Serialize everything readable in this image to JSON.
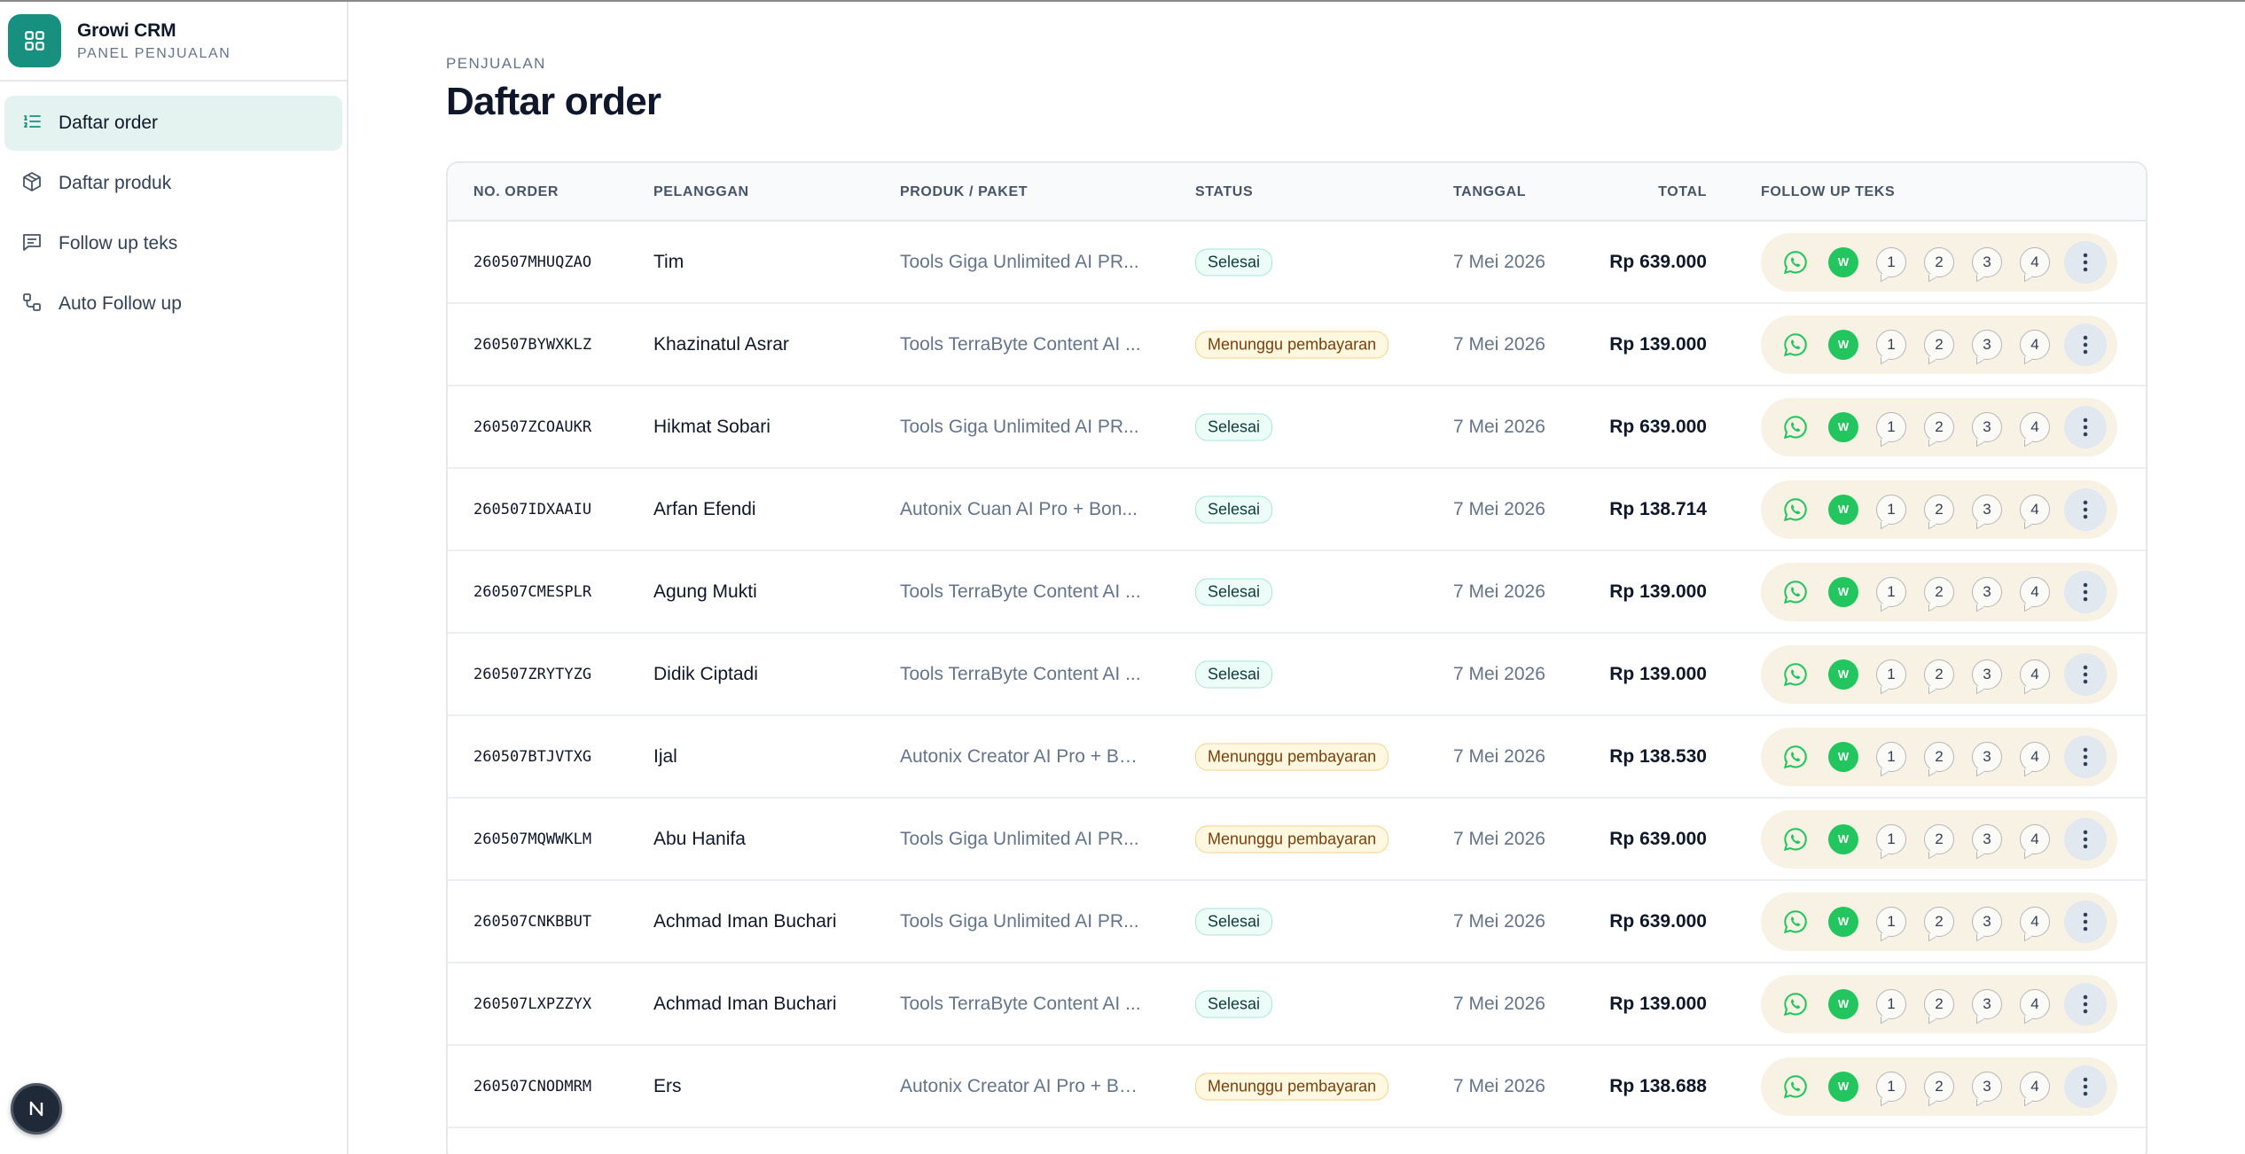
{
  "app": {
    "name": "Growi CRM",
    "subtitle": "PANEL PENJUALAN"
  },
  "sidebar": {
    "items": [
      {
        "label": "Daftar order",
        "icon": "list-order-icon",
        "active": true
      },
      {
        "label": "Daftar produk",
        "icon": "package-icon",
        "active": false
      },
      {
        "label": "Follow up teks",
        "icon": "message-text-icon",
        "active": false
      },
      {
        "label": "Auto Follow up",
        "icon": "workflow-icon",
        "active": false
      }
    ]
  },
  "next_badge": {
    "letter": "N"
  },
  "header": {
    "eyebrow": "PENJUALAN",
    "title": "Daftar order"
  },
  "table": {
    "columns": {
      "order": "NO. ORDER",
      "customer": "PELANGGAN",
      "product": "PRODUK / PAKET",
      "status": "STATUS",
      "date": "TANGGAL",
      "total": "TOTAL",
      "followup": "FOLLOW UP TEKS"
    },
    "rows": [
      {
        "order": "260507MHUQZAO",
        "customer": "Tim",
        "product": "Tools Giga Unlimited AI PR...",
        "status": "Selesai",
        "status_type": "done",
        "date": "7 Mei 2026",
        "total": "Rp 639.000"
      },
      {
        "order": "260507BYWXKLZ",
        "customer": "Khazinatul Asrar",
        "product": "Tools TerraByte Content AI ...",
        "status": "Menunggu pembayaran",
        "status_type": "wait",
        "date": "7 Mei 2026",
        "total": "Rp 139.000"
      },
      {
        "order": "260507ZCOAUKR",
        "customer": "Hikmat Sobari",
        "product": "Tools Giga Unlimited AI PR...",
        "status": "Selesai",
        "status_type": "done",
        "date": "7 Mei 2026",
        "total": "Rp 639.000"
      },
      {
        "order": "260507IDXAAIU",
        "customer": "Arfan Efendi",
        "product": "Autonix Cuan AI Pro + Bon...",
        "status": "Selesai",
        "status_type": "done",
        "date": "7 Mei 2026",
        "total": "Rp 138.714"
      },
      {
        "order": "260507CMESPLR",
        "customer": "Agung Mukti",
        "product": "Tools TerraByte Content AI ...",
        "status": "Selesai",
        "status_type": "done",
        "date": "7 Mei 2026",
        "total": "Rp 139.000"
      },
      {
        "order": "260507ZRYTYZG",
        "customer": "Didik Ciptadi",
        "product": "Tools TerraByte Content AI ...",
        "status": "Selesai",
        "status_type": "done",
        "date": "7 Mei 2026",
        "total": "Rp 139.000"
      },
      {
        "order": "260507BTJVTXG",
        "customer": "Ijal",
        "product": "Autonix Creator AI Pro + Bo...",
        "status": "Menunggu pembayaran",
        "status_type": "wait",
        "date": "7 Mei 2026",
        "total": "Rp 138.530"
      },
      {
        "order": "260507MQWWKLM",
        "customer": "Abu Hanifa",
        "product": "Tools Giga Unlimited AI PR...",
        "status": "Menunggu pembayaran",
        "status_type": "wait",
        "date": "7 Mei 2026",
        "total": "Rp 639.000"
      },
      {
        "order": "260507CNKBBUT",
        "customer": "Achmad Iman Buchari",
        "product": "Tools Giga Unlimited AI PR...",
        "status": "Selesai",
        "status_type": "done",
        "date": "7 Mei 2026",
        "total": "Rp 639.000"
      },
      {
        "order": "260507LXPZZYX",
        "customer": "Achmad Iman Buchari",
        "product": "Tools TerraByte Content AI ...",
        "status": "Selesai",
        "status_type": "done",
        "date": "7 Mei 2026",
        "total": "Rp 139.000"
      },
      {
        "order": "260507CNODMRM",
        "customer": "Ers",
        "product": "Autonix Creator AI Pro + Bo...",
        "status": "Menunggu pembayaran",
        "status_type": "wait",
        "date": "7 Mei 2026",
        "total": "Rp 138.688"
      }
    ],
    "followup_buttons": {
      "wa_icon": "whatsapp-icon",
      "w_label": "W",
      "numbers": [
        "1",
        "2",
        "3",
        "4"
      ],
      "more_icon": "more-vertical-icon"
    }
  },
  "colors": {
    "brand": "#17907f",
    "active_bg": "#e4f3f0",
    "wa_green": "#22c55e",
    "followup_bg": "#f7f2e4"
  }
}
